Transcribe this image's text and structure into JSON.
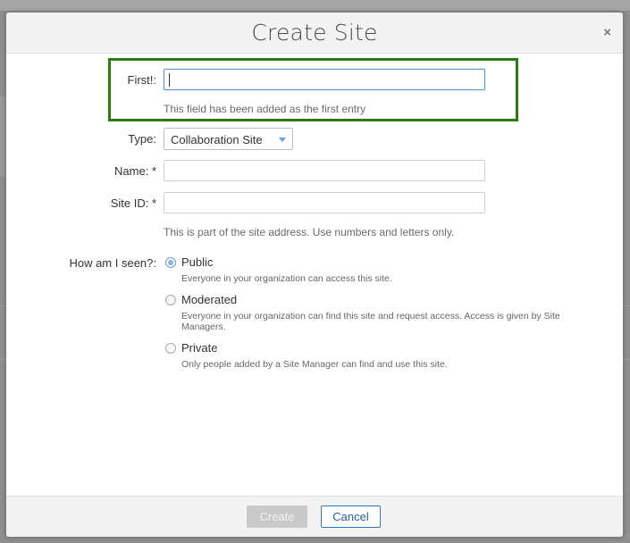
{
  "dialog": {
    "title": "Create Site",
    "close_glyph": "×"
  },
  "form": {
    "first": {
      "label": "First!:",
      "value": "",
      "help": "This field has been added as the first entry"
    },
    "type": {
      "label": "Type:",
      "selected": "Collaboration Site"
    },
    "name": {
      "label": "Name: *",
      "value": ""
    },
    "site_id": {
      "label": "Site ID: *",
      "value": "",
      "help": "This is part of the site address. Use numbers and letters only."
    },
    "visibility": {
      "label": "How am I seen?:",
      "selected": "Public",
      "options": [
        {
          "label": "Public",
          "desc": "Everyone in your organization can access this site."
        },
        {
          "label": "Moderated",
          "desc": "Everyone in your organization can find this site and request access. Access is given by Site Managers."
        },
        {
          "label": "Private",
          "desc": "Only people added by a Site Manager can find and use this site."
        }
      ]
    }
  },
  "footer": {
    "create_label": "Create",
    "cancel_label": "Cancel"
  },
  "colors": {
    "highlight_border": "#2d7a10",
    "focus_border": "#5b9bd5",
    "cancel_border": "#2e77c2"
  }
}
